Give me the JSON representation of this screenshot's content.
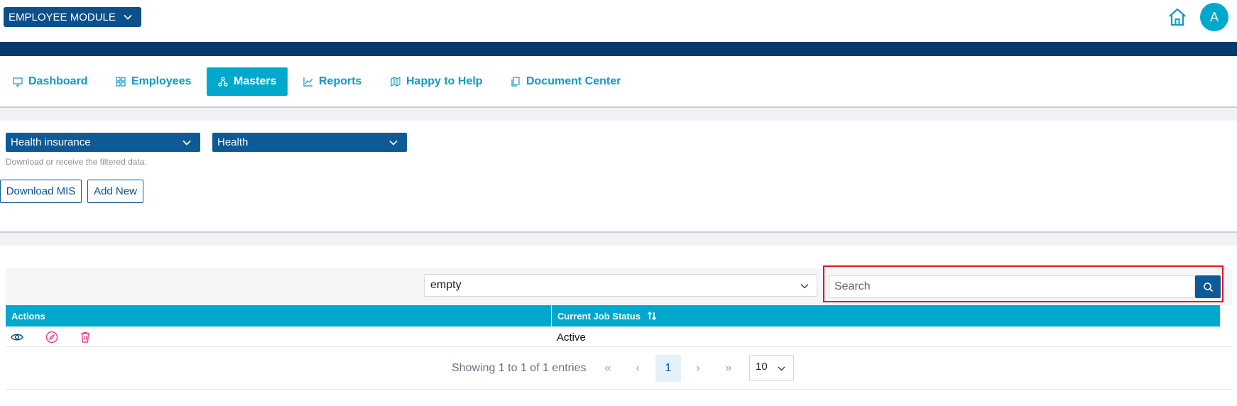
{
  "header": {
    "module_label": "EMPLOYEE MODULE",
    "avatar_initial": "A"
  },
  "nav": {
    "items": [
      {
        "label": "Dashboard",
        "icon": "monitor-icon"
      },
      {
        "label": "Employees",
        "icon": "grid-icon"
      },
      {
        "label": "Masters",
        "icon": "hierarchy-icon",
        "active": true
      },
      {
        "label": "Reports",
        "icon": "line-chart-icon"
      },
      {
        "label": "Happy to Help",
        "icon": "map-icon"
      },
      {
        "label": "Document Center",
        "icon": "documents-icon"
      }
    ]
  },
  "filters": {
    "category_value": "Health insurance",
    "subcategory_value": "Health",
    "hint": "Download or receive the filtered data."
  },
  "actions": {
    "download_label": "Download MIS",
    "add_label": "Add New"
  },
  "table": {
    "column_select_value": "empty",
    "search_placeholder": "Search",
    "headers": [
      "Actions",
      "Current Job Status"
    ],
    "rows": [
      {
        "status": "Active"
      }
    ]
  },
  "pagination": {
    "info": "Showing 1 to 1 of 1 entries",
    "first": "«",
    "prev": "‹",
    "current_page": "1",
    "next": "›",
    "last": "»",
    "page_size": "10"
  },
  "colors": {
    "primary": "#0d5a97",
    "accent": "#00a8cc",
    "navbar_dark": "#063a6b",
    "highlight": "#e8121c"
  }
}
